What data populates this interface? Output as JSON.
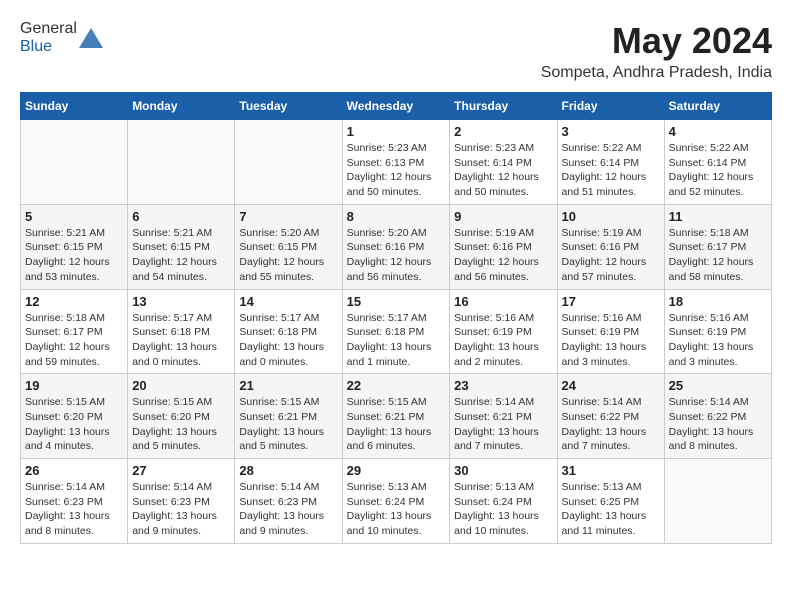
{
  "header": {
    "logo_general": "General",
    "logo_blue": "Blue",
    "month_year": "May 2024",
    "location": "Sompeta, Andhra Pradesh, India"
  },
  "days_of_week": [
    "Sunday",
    "Monday",
    "Tuesday",
    "Wednesday",
    "Thursday",
    "Friday",
    "Saturday"
  ],
  "weeks": [
    [
      {
        "day": "",
        "info": ""
      },
      {
        "day": "",
        "info": ""
      },
      {
        "day": "",
        "info": ""
      },
      {
        "day": "1",
        "info": "Sunrise: 5:23 AM\nSunset: 6:13 PM\nDaylight: 12 hours\nand 50 minutes."
      },
      {
        "day": "2",
        "info": "Sunrise: 5:23 AM\nSunset: 6:14 PM\nDaylight: 12 hours\nand 50 minutes."
      },
      {
        "day": "3",
        "info": "Sunrise: 5:22 AM\nSunset: 6:14 PM\nDaylight: 12 hours\nand 51 minutes."
      },
      {
        "day": "4",
        "info": "Sunrise: 5:22 AM\nSunset: 6:14 PM\nDaylight: 12 hours\nand 52 minutes."
      }
    ],
    [
      {
        "day": "5",
        "info": "Sunrise: 5:21 AM\nSunset: 6:15 PM\nDaylight: 12 hours\nand 53 minutes."
      },
      {
        "day": "6",
        "info": "Sunrise: 5:21 AM\nSunset: 6:15 PM\nDaylight: 12 hours\nand 54 minutes."
      },
      {
        "day": "7",
        "info": "Sunrise: 5:20 AM\nSunset: 6:15 PM\nDaylight: 12 hours\nand 55 minutes."
      },
      {
        "day": "8",
        "info": "Sunrise: 5:20 AM\nSunset: 6:16 PM\nDaylight: 12 hours\nand 56 minutes."
      },
      {
        "day": "9",
        "info": "Sunrise: 5:19 AM\nSunset: 6:16 PM\nDaylight: 12 hours\nand 56 minutes."
      },
      {
        "day": "10",
        "info": "Sunrise: 5:19 AM\nSunset: 6:16 PM\nDaylight: 12 hours\nand 57 minutes."
      },
      {
        "day": "11",
        "info": "Sunrise: 5:18 AM\nSunset: 6:17 PM\nDaylight: 12 hours\nand 58 minutes."
      }
    ],
    [
      {
        "day": "12",
        "info": "Sunrise: 5:18 AM\nSunset: 6:17 PM\nDaylight: 12 hours\nand 59 minutes."
      },
      {
        "day": "13",
        "info": "Sunrise: 5:17 AM\nSunset: 6:18 PM\nDaylight: 13 hours\nand 0 minutes."
      },
      {
        "day": "14",
        "info": "Sunrise: 5:17 AM\nSunset: 6:18 PM\nDaylight: 13 hours\nand 0 minutes."
      },
      {
        "day": "15",
        "info": "Sunrise: 5:17 AM\nSunset: 6:18 PM\nDaylight: 13 hours\nand 1 minute."
      },
      {
        "day": "16",
        "info": "Sunrise: 5:16 AM\nSunset: 6:19 PM\nDaylight: 13 hours\nand 2 minutes."
      },
      {
        "day": "17",
        "info": "Sunrise: 5:16 AM\nSunset: 6:19 PM\nDaylight: 13 hours\nand 3 minutes."
      },
      {
        "day": "18",
        "info": "Sunrise: 5:16 AM\nSunset: 6:19 PM\nDaylight: 13 hours\nand 3 minutes."
      }
    ],
    [
      {
        "day": "19",
        "info": "Sunrise: 5:15 AM\nSunset: 6:20 PM\nDaylight: 13 hours\nand 4 minutes."
      },
      {
        "day": "20",
        "info": "Sunrise: 5:15 AM\nSunset: 6:20 PM\nDaylight: 13 hours\nand 5 minutes."
      },
      {
        "day": "21",
        "info": "Sunrise: 5:15 AM\nSunset: 6:21 PM\nDaylight: 13 hours\nand 5 minutes."
      },
      {
        "day": "22",
        "info": "Sunrise: 5:15 AM\nSunset: 6:21 PM\nDaylight: 13 hours\nand 6 minutes."
      },
      {
        "day": "23",
        "info": "Sunrise: 5:14 AM\nSunset: 6:21 PM\nDaylight: 13 hours\nand 7 minutes."
      },
      {
        "day": "24",
        "info": "Sunrise: 5:14 AM\nSunset: 6:22 PM\nDaylight: 13 hours\nand 7 minutes."
      },
      {
        "day": "25",
        "info": "Sunrise: 5:14 AM\nSunset: 6:22 PM\nDaylight: 13 hours\nand 8 minutes."
      }
    ],
    [
      {
        "day": "26",
        "info": "Sunrise: 5:14 AM\nSunset: 6:23 PM\nDaylight: 13 hours\nand 8 minutes."
      },
      {
        "day": "27",
        "info": "Sunrise: 5:14 AM\nSunset: 6:23 PM\nDaylight: 13 hours\nand 9 minutes."
      },
      {
        "day": "28",
        "info": "Sunrise: 5:14 AM\nSunset: 6:23 PM\nDaylight: 13 hours\nand 9 minutes."
      },
      {
        "day": "29",
        "info": "Sunrise: 5:13 AM\nSunset: 6:24 PM\nDaylight: 13 hours\nand 10 minutes."
      },
      {
        "day": "30",
        "info": "Sunrise: 5:13 AM\nSunset: 6:24 PM\nDaylight: 13 hours\nand 10 minutes."
      },
      {
        "day": "31",
        "info": "Sunrise: 5:13 AM\nSunset: 6:25 PM\nDaylight: 13 hours\nand 11 minutes."
      },
      {
        "day": "",
        "info": ""
      }
    ]
  ]
}
